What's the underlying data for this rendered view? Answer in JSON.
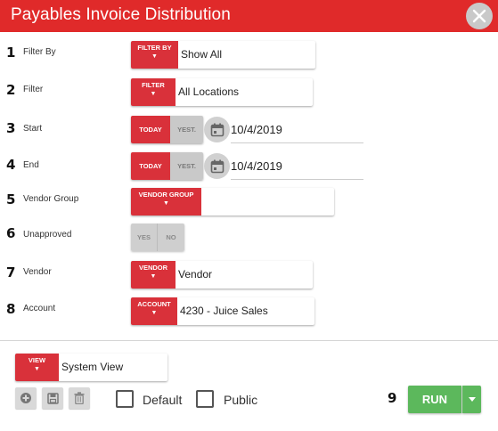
{
  "title": "Payables Invoice Distribution",
  "fields": [
    {
      "num": "1",
      "label": "Filter By",
      "button": "FILTER BY",
      "value": "Show All"
    },
    {
      "num": "2",
      "label": "Filter",
      "button": "FILTER",
      "value": "All Locations"
    },
    {
      "num": "3",
      "label": "Start",
      "today": "TODAY",
      "yest": "YEST.",
      "value": "10/4/2019"
    },
    {
      "num": "4",
      "label": "End",
      "today": "TODAY",
      "yest": "YEST.",
      "value": "10/4/2019"
    },
    {
      "num": "5",
      "label": "Vendor Group",
      "button": "VENDOR GROUP",
      "value": ""
    },
    {
      "num": "6",
      "label": "Unapproved",
      "yes": "YES",
      "no": "NO"
    },
    {
      "num": "7",
      "label": "Vendor",
      "button": "VENDOR",
      "value": "Vendor"
    },
    {
      "num": "8",
      "label": "Account",
      "button": "ACCOUNT",
      "value": "4230 - Juice Sales"
    }
  ],
  "footer": {
    "view_button": "VIEW",
    "view_value": "System View",
    "default_label": "Default",
    "public_label": "Public",
    "step_num": "9",
    "run_label": "RUN"
  },
  "icons": [
    "close-icon",
    "calendar-icon",
    "plus-icon",
    "save-icon",
    "trash-icon",
    "caret-down-icon"
  ],
  "colors": {
    "accent": "#e02a2a",
    "button_red": "#d9313a",
    "run_green": "#5cb85c",
    "toggle_gray": "#c9c9c9"
  }
}
